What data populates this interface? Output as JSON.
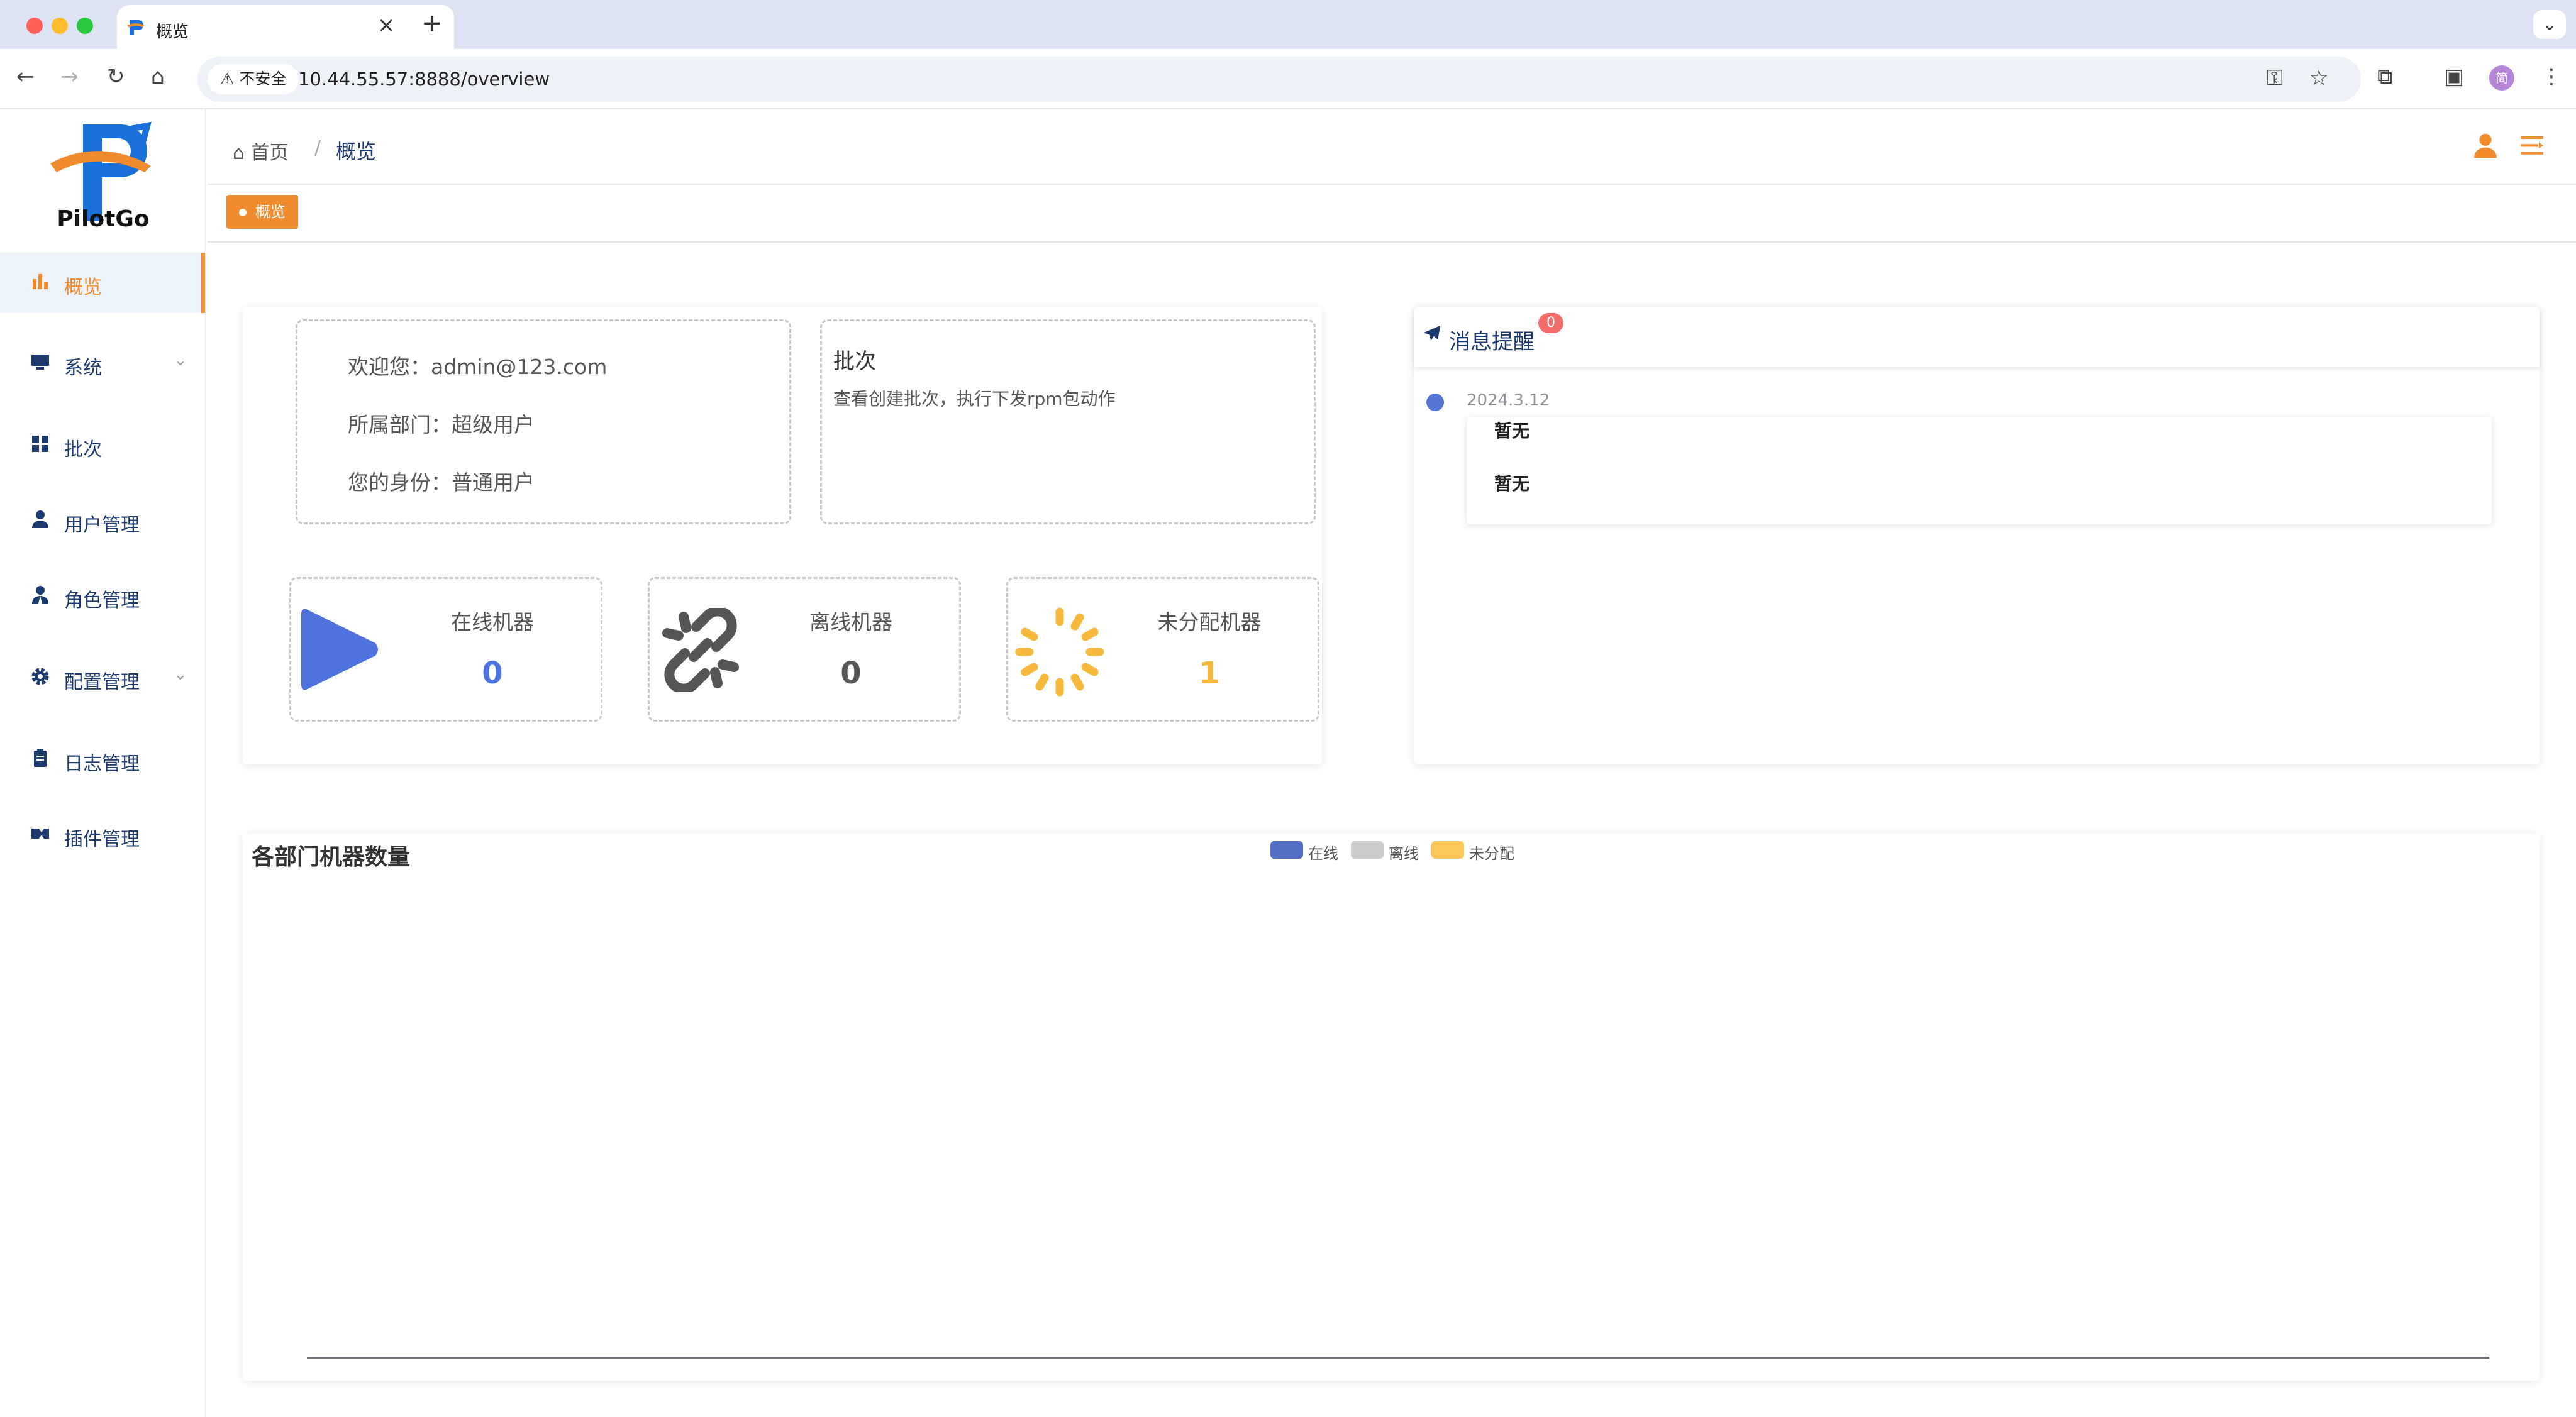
{
  "browser": {
    "tab_title": "概览",
    "security_label": "不安全",
    "url": "10.44.55.57:8888/overview",
    "new_tab": "+",
    "close_tab": "×",
    "profile_initial": "简"
  },
  "sidebar": {
    "logo_text": "PilotGo",
    "items": [
      {
        "label": "概览",
        "icon": "chart-bar-icon",
        "active": true
      },
      {
        "label": "系统",
        "icon": "monitor-icon",
        "has_submenu": true
      },
      {
        "label": "批次",
        "icon": "grid-icon"
      },
      {
        "label": "用户管理",
        "icon": "user-icon"
      },
      {
        "label": "角色管理",
        "icon": "role-icon"
      },
      {
        "label": "配置管理",
        "icon": "gear-icon",
        "has_submenu": true
      },
      {
        "label": "日志管理",
        "icon": "clipboard-icon"
      },
      {
        "label": "插件管理",
        "icon": "plugin-icon"
      }
    ]
  },
  "header": {
    "breadcrumb_home": "首页",
    "breadcrumb_sep": "/",
    "breadcrumb_current": "概览"
  },
  "tags": {
    "active_tag": "概览"
  },
  "welcome": {
    "line1": "欢迎您：admin@123.com",
    "line2": "所属部门：超级用户",
    "line3": "您的身份：普通用户"
  },
  "batch": {
    "title": "批次",
    "description": "查看创建批次，执行下发rpm包动作"
  },
  "stats": [
    {
      "label": "在线机器",
      "value": "0",
      "color": "#4e73df",
      "icon": "play-icon"
    },
    {
      "label": "离线机器",
      "value": "0",
      "color": "#555555",
      "icon": "broken-link-icon"
    },
    {
      "label": "未分配机器",
      "value": "1",
      "color": "#f6b93b",
      "icon": "spinner-icon"
    }
  ],
  "messages": {
    "title": "消息提醒",
    "badge_count": "0",
    "date": "2024.3.12",
    "item1": "暂无",
    "item2": "暂无"
  },
  "chart_data": {
    "type": "bar",
    "title": "各部门机器数量",
    "categories": [],
    "series": [
      {
        "name": "在线",
        "values": [],
        "color": "#5470c6"
      },
      {
        "name": "离线",
        "values": [],
        "color": "#cccccc"
      },
      {
        "name": "未分配",
        "values": [],
        "color": "#fac858"
      }
    ],
    "legend_position": "top-center"
  }
}
